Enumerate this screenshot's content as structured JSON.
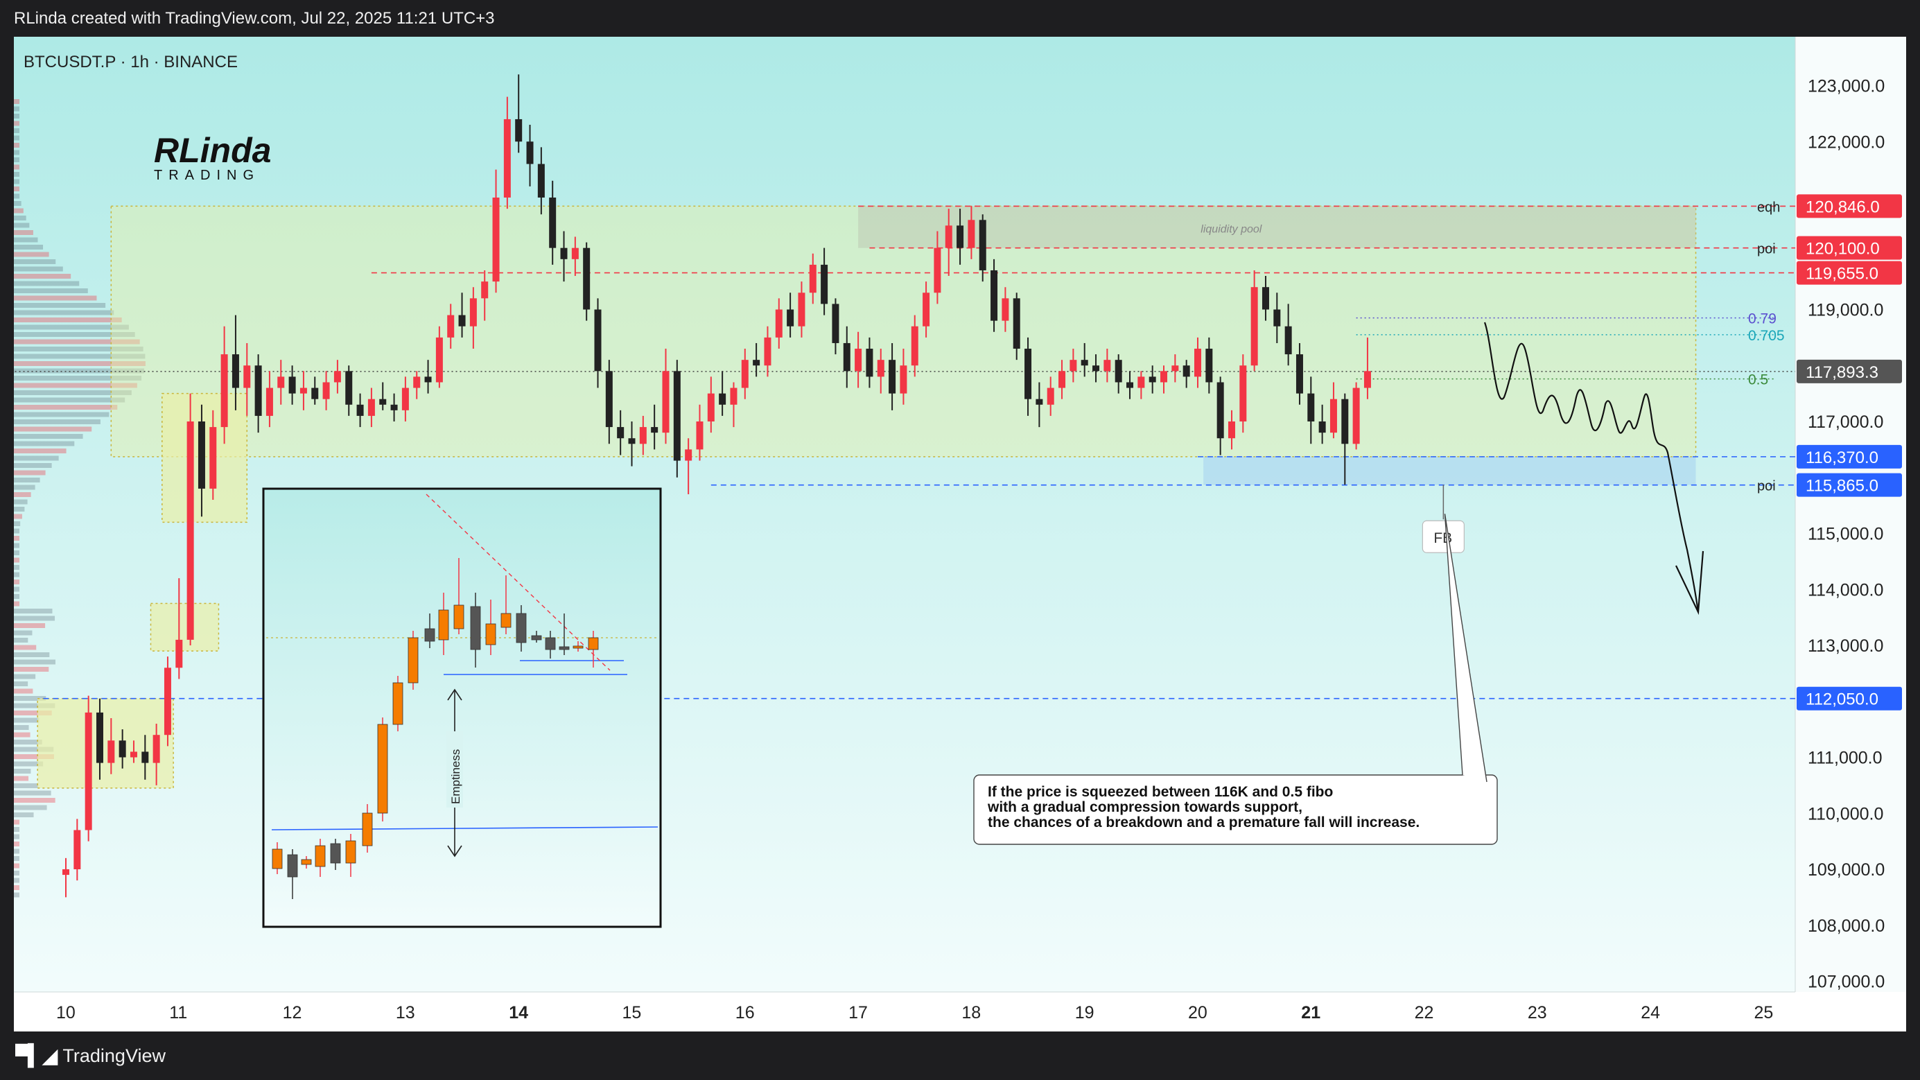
{
  "header": {
    "attribution": "RLinda created with TradingView.com, Jul 22, 2025 11:21 UTC+3"
  },
  "footer": {
    "brand": "TradingView",
    "brand_icon": "tradingview-logo-icon"
  },
  "logo": {
    "text_top": "RLinda",
    "text_bottom": "TRADING"
  },
  "colors": {
    "bull": "#f23645",
    "bear": "#222222",
    "red_label": "#f23645",
    "blue_label": "#2962ff",
    "current_label": "#555555",
    "zone_yellow": "#e9f0a8",
    "bg_top": "#aeeae6",
    "bg_bottom": "#f2fcfc"
  },
  "chart_data": {
    "type": "candlestick",
    "title": "BTCUSDT.P · 1h · BINANCE",
    "x_axis_ticks": [
      {
        "label": "10",
        "bold": false
      },
      {
        "label": "11",
        "bold": false
      },
      {
        "label": "12",
        "bold": false
      },
      {
        "label": "13",
        "bold": false
      },
      {
        "label": "14",
        "bold": true
      },
      {
        "label": "15",
        "bold": false
      },
      {
        "label": "16",
        "bold": false
      },
      {
        "label": "17",
        "bold": false
      },
      {
        "label": "18",
        "bold": false
      },
      {
        "label": "19",
        "bold": false
      },
      {
        "label": "20",
        "bold": false
      },
      {
        "label": "21",
        "bold": true
      },
      {
        "label": "22",
        "bold": false
      },
      {
        "label": "23",
        "bold": false
      },
      {
        "label": "24",
        "bold": false
      },
      {
        "label": "25",
        "bold": false
      }
    ],
    "x_range": [
      9.55,
      25.4
    ],
    "y_axis_ticks": [
      {
        "value": 123000,
        "label": "123,000.0"
      },
      {
        "value": 122000,
        "label": "122,000.0"
      },
      {
        "value": 119000,
        "label": "119,000.0"
      },
      {
        "value": 117000,
        "label": "117,000.0"
      },
      {
        "value": 115000,
        "label": "115,000.0"
      },
      {
        "value": 114000,
        "label": "114,000.0"
      },
      {
        "value": 113000,
        "label": "113,000.0"
      },
      {
        "value": 111000,
        "label": "111,000.0"
      },
      {
        "value": 110000,
        "label": "110,000.0"
      },
      {
        "value": 109000,
        "label": "109,000.0"
      },
      {
        "value": 108000,
        "label": "108,000.0"
      },
      {
        "value": 107000,
        "label": "107,000.0"
      }
    ],
    "ylim": [
      106800,
      123800
    ],
    "levels": [
      {
        "value": 120846,
        "label": "120,846.0",
        "tag": "eqh",
        "color": "red",
        "style": "dashed-red",
        "x_start": 17.0
      },
      {
        "value": 120100,
        "label": "120,100.0",
        "tag": "poi",
        "color": "red",
        "style": "dashed-red",
        "x_start": 17.1
      },
      {
        "value": 119655,
        "label": "119,655.0",
        "tag": "",
        "color": "red",
        "style": "dashed-red",
        "x_start": 12.7
      },
      {
        "value": 117893.3,
        "label": "117,893.3",
        "tag": "",
        "color": "current",
        "style": "dotted-dark",
        "x_start": 9.55
      },
      {
        "value": 116370,
        "label": "116,370.0",
        "tag": "",
        "color": "blue",
        "style": "dashed-blue",
        "x_start": 20.0
      },
      {
        "value": 115865,
        "label": "115,865.0",
        "tag": "poi",
        "color": "blue",
        "style": "dashed-blue",
        "x_start": 15.7
      },
      {
        "value": 112050,
        "label": "112,050.0",
        "tag": "",
        "color": "blue",
        "style": "dashed-blue",
        "x_start": 9.8
      }
    ],
    "fib_levels": [
      {
        "ratio": "0.79",
        "value": 118850,
        "color": "#5b4fcf"
      },
      {
        "ratio": "0.705",
        "value": 118550,
        "color": "#1aa6b8"
      },
      {
        "ratio": "0.5",
        "value": 117760,
        "color": "#3b8a3b"
      }
    ],
    "zones": [
      {
        "x0": 10.4,
        "x1": 24.4,
        "y0": 116370,
        "y1": 120846,
        "kind": "range"
      },
      {
        "x0": 17.0,
        "x1": 24.4,
        "y0": 120100,
        "y1": 120846,
        "kind": "liquidity",
        "label": "liquidity pool"
      },
      {
        "x0": 20.05,
        "x1": 24.4,
        "y0": 115865,
        "y1": 116370,
        "kind": "blue"
      },
      {
        "x0": 9.75,
        "x1": 10.95,
        "y0": 110450,
        "y1": 112050,
        "kind": "ob"
      },
      {
        "x0": 10.75,
        "x1": 11.35,
        "y0": 112900,
        "y1": 113750,
        "kind": "ob"
      },
      {
        "x0": 10.85,
        "x1": 11.6,
        "y0": 115200,
        "y1": 117500,
        "kind": "ob"
      }
    ],
    "fb_marker": {
      "label": "FB",
      "x": 22.17,
      "y": 115870
    },
    "annotation": {
      "lines": [
        "If the price is squeezed between 116K and 0.5 fibo",
        "with a gradual compression towards support,",
        "the chances of a breakdown and a premature fall will increase."
      ]
    },
    "inset": {
      "label": "Emptiness"
    },
    "candles_ohlc": [
      [
        10.0,
        108900,
        109200,
        108500,
        109000
      ],
      [
        10.1,
        109000,
        109900,
        108800,
        109700
      ],
      [
        10.2,
        109700,
        112100,
        109500,
        111800
      ],
      [
        10.3,
        111800,
        112050,
        110600,
        110900
      ],
      [
        10.4,
        110900,
        111700,
        110700,
        111300
      ],
      [
        10.5,
        111300,
        111500,
        110800,
        111000
      ],
      [
        10.6,
        111000,
        111300,
        110900,
        111100
      ],
      [
        10.7,
        111100,
        111400,
        110600,
        110900
      ],
      [
        10.8,
        110900,
        111600,
        110500,
        111400
      ],
      [
        10.9,
        111400,
        112800,
        111200,
        112600
      ],
      [
        11.0,
        112600,
        114200,
        112400,
        113100
      ],
      [
        11.1,
        113100,
        117500,
        113000,
        117000
      ],
      [
        11.2,
        117000,
        117300,
        115300,
        115800
      ],
      [
        11.3,
        115800,
        117200,
        115600,
        116900
      ],
      [
        11.4,
        116900,
        118700,
        116600,
        118200
      ],
      [
        11.5,
        118200,
        118900,
        117200,
        117600
      ],
      [
        11.6,
        117600,
        118400,
        117100,
        118000
      ],
      [
        11.7,
        118000,
        118200,
        116800,
        117100
      ],
      [
        11.8,
        117100,
        117900,
        116900,
        117600
      ],
      [
        11.9,
        117600,
        118100,
        117300,
        117800
      ],
      [
        12.0,
        117800,
        118000,
        117300,
        117500
      ],
      [
        12.1,
        117500,
        117900,
        117200,
        117600
      ],
      [
        12.2,
        117600,
        117800,
        117300,
        117400
      ],
      [
        12.3,
        117400,
        117900,
        117200,
        117700
      ],
      [
        12.4,
        117700,
        118100,
        117500,
        117900
      ],
      [
        12.5,
        117900,
        118000,
        117100,
        117300
      ],
      [
        12.6,
        117300,
        117500,
        116900,
        117100
      ],
      [
        12.7,
        117100,
        117600,
        116900,
        117400
      ],
      [
        12.8,
        117400,
        117700,
        117200,
        117300
      ],
      [
        12.9,
        117300,
        117500,
        117000,
        117200
      ],
      [
        13.0,
        117200,
        117800,
        117000,
        117600
      ],
      [
        13.1,
        117600,
        117900,
        117400,
        117800
      ],
      [
        13.2,
        117800,
        118100,
        117500,
        117700
      ],
      [
        13.3,
        117700,
        118700,
        117600,
        118500
      ],
      [
        13.4,
        118500,
        119100,
        118300,
        118900
      ],
      [
        13.5,
        118900,
        119300,
        118500,
        118700
      ],
      [
        13.6,
        118700,
        119400,
        118300,
        119200
      ],
      [
        13.7,
        119200,
        119700,
        118800,
        119500
      ],
      [
        13.8,
        119500,
        121500,
        119300,
        121000
      ],
      [
        13.9,
        121000,
        122800,
        120800,
        122400
      ],
      [
        14.0,
        122400,
        123200,
        121800,
        122000
      ],
      [
        14.1,
        122000,
        122300,
        121200,
        121600
      ],
      [
        14.2,
        121600,
        121900,
        120700,
        121000
      ],
      [
        14.3,
        121000,
        121300,
        119800,
        120100
      ],
      [
        14.4,
        120100,
        120400,
        119500,
        119900
      ],
      [
        14.5,
        119900,
        120300,
        119600,
        120100
      ],
      [
        14.6,
        120100,
        120200,
        118800,
        119000
      ],
      [
        14.7,
        119000,
        119200,
        117600,
        117900
      ],
      [
        14.8,
        117900,
        118100,
        116600,
        116900
      ],
      [
        14.9,
        116900,
        117200,
        116400,
        116700
      ],
      [
        15.0,
        116700,
        117000,
        116200,
        116600
      ],
      [
        15.1,
        116600,
        117100,
        116400,
        116900
      ],
      [
        15.2,
        116900,
        117300,
        116500,
        116800
      ],
      [
        15.3,
        116800,
        118300,
        116600,
        117900
      ],
      [
        15.4,
        117900,
        118100,
        116000,
        116300
      ],
      [
        15.5,
        116300,
        116700,
        115700,
        116500
      ],
      [
        15.6,
        116500,
        117300,
        116300,
        117000
      ],
      [
        15.7,
        117000,
        117800,
        116800,
        117500
      ],
      [
        15.8,
        117500,
        117900,
        117100,
        117300
      ],
      [
        15.9,
        117300,
        117700,
        116900,
        117600
      ],
      [
        16.0,
        117600,
        118300,
        117400,
        118100
      ],
      [
        16.1,
        118100,
        118400,
        117800,
        118000
      ],
      [
        16.2,
        118000,
        118700,
        117800,
        118500
      ],
      [
        16.3,
        118500,
        119200,
        118300,
        119000
      ],
      [
        16.4,
        119000,
        119300,
        118500,
        118700
      ],
      [
        16.5,
        118700,
        119500,
        118500,
        119300
      ],
      [
        16.6,
        119300,
        120000,
        119100,
        119800
      ],
      [
        16.7,
        119800,
        120100,
        118900,
        119100
      ],
      [
        16.8,
        119100,
        119200,
        118200,
        118400
      ],
      [
        16.9,
        118400,
        118700,
        117600,
        117900
      ],
      [
        17.0,
        117900,
        118600,
        117600,
        118300
      ],
      [
        17.1,
        118300,
        118500,
        117600,
        117800
      ],
      [
        17.2,
        117800,
        118300,
        117500,
        118100
      ],
      [
        17.3,
        118100,
        118400,
        117200,
        117500
      ],
      [
        17.4,
        117500,
        118300,
        117300,
        118000
      ],
      [
        17.5,
        118000,
        118900,
        117800,
        118700
      ],
      [
        17.6,
        118700,
        119500,
        118500,
        119300
      ],
      [
        17.7,
        119300,
        120400,
        119100,
        120100
      ],
      [
        17.8,
        120100,
        120800,
        119600,
        120500
      ],
      [
        17.9,
        120500,
        120800,
        119800,
        120100
      ],
      [
        18.0,
        120100,
        120850,
        119900,
        120600
      ],
      [
        18.1,
        120600,
        120700,
        119500,
        119700
      ],
      [
        18.2,
        119700,
        119900,
        118600,
        118800
      ],
      [
        18.3,
        118800,
        119400,
        118600,
        119200
      ],
      [
        18.4,
        119200,
        119300,
        118100,
        118300
      ],
      [
        18.5,
        118300,
        118500,
        117100,
        117400
      ],
      [
        18.6,
        117400,
        117700,
        116900,
        117300
      ],
      [
        18.7,
        117300,
        117800,
        117100,
        117600
      ],
      [
        18.8,
        117600,
        118100,
        117400,
        117900
      ],
      [
        18.9,
        117900,
        118300,
        117700,
        118100
      ],
      [
        19.0,
        118100,
        118400,
        117800,
        118000
      ],
      [
        19.1,
        118000,
        118200,
        117700,
        117900
      ],
      [
        19.2,
        117900,
        118300,
        117700,
        118100
      ],
      [
        19.3,
        118100,
        118200,
        117500,
        117700
      ],
      [
        19.4,
        117700,
        117900,
        117400,
        117600
      ],
      [
        19.5,
        117600,
        117900,
        117400,
        117800
      ],
      [
        19.6,
        117800,
        118000,
        117500,
        117700
      ],
      [
        19.7,
        117700,
        118000,
        117500,
        117900
      ],
      [
        19.8,
        117900,
        118200,
        117700,
        118000
      ],
      [
        19.9,
        118000,
        118100,
        117600,
        117800
      ],
      [
        20.0,
        117800,
        118500,
        117600,
        118300
      ],
      [
        20.1,
        118300,
        118500,
        117500,
        117700
      ],
      [
        20.2,
        117700,
        117800,
        116400,
        116700
      ],
      [
        20.3,
        116700,
        117200,
        116500,
        117000
      ],
      [
        20.4,
        117000,
        118200,
        116800,
        118000
      ],
      [
        20.5,
        118000,
        119700,
        117900,
        119400
      ],
      [
        20.6,
        119400,
        119600,
        118800,
        119000
      ],
      [
        20.7,
        119000,
        119300,
        118400,
        118700
      ],
      [
        20.8,
        118700,
        119100,
        118000,
        118200
      ],
      [
        20.9,
        118200,
        118400,
        117300,
        117500
      ],
      [
        21.0,
        117500,
        117800,
        116600,
        117000
      ],
      [
        21.1,
        117000,
        117300,
        116600,
        116800
      ],
      [
        21.2,
        116800,
        117700,
        116700,
        117400
      ],
      [
        21.3,
        117400,
        117500,
        115870,
        116600
      ],
      [
        21.4,
        116600,
        117700,
        116500,
        117600
      ],
      [
        21.5,
        117600,
        118500,
        117400,
        117900
      ]
    ]
  }
}
